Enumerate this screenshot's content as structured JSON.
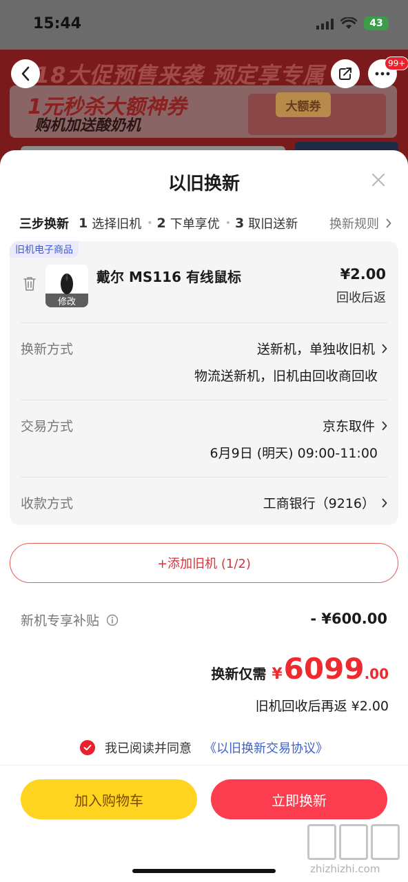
{
  "status_bar": {
    "time": "15:44",
    "battery": "43"
  },
  "background": {
    "banner_title": "18大促预售来袭 预定享专属",
    "promo_line1": "1元秒杀大额神券",
    "promo_line2": "购机加送酸奶机",
    "coupon_label": "大额券",
    "more_badge": "99+"
  },
  "sheet": {
    "title": "以旧换新",
    "steps_title": "三步换新",
    "steps": [
      {
        "num": "1",
        "label": "选择旧机"
      },
      {
        "num": "2",
        "label": "下单享优"
      },
      {
        "num": "3",
        "label": "取旧送新"
      }
    ],
    "rules_label": "换新规则"
  },
  "old_item": {
    "tag": "旧机电子商品",
    "name": "戴尔 MS116 有线鼠标",
    "modify_label": "修改",
    "price": "¥2.00",
    "price_note": "回收后返"
  },
  "rows": [
    {
      "label": "换新方式",
      "value": "送新机，单独收旧机",
      "sub": "物流送新机，旧机由回收商回收"
    },
    {
      "label": "交易方式",
      "value": "京东取件",
      "sub": "6月9日 (明天) 09:00-11:00"
    },
    {
      "label": "收款方式",
      "value": "工商银行（9216）"
    }
  ],
  "add_button": "+添加旧机 (1/2)",
  "subsidy": {
    "label": "新机专享补贴",
    "value": "- ¥600.00"
  },
  "total": {
    "label": "换新仅需",
    "currency": "¥",
    "integer": "6099",
    "decimal": ".00"
  },
  "refund_note": "旧机回收后再返 ¥2.00",
  "agreement": {
    "text": "我已阅读并同意",
    "link": "《以旧换新交易协议》",
    "checked": true
  },
  "actions": {
    "cart": "加入购物车",
    "buy": "立即换新"
  },
  "watermark": {
    "text": "zhizhizhi.com"
  },
  "colors": {
    "accent_red": "#ee2a2f",
    "button_red": "#fb3d4f",
    "button_yellow": "#ffd522",
    "link_blue": "#3e62c8"
  }
}
